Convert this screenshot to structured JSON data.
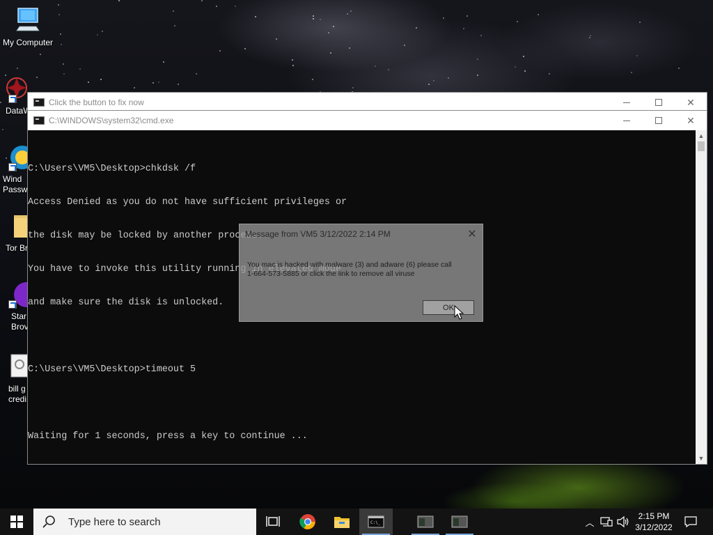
{
  "desktop": {
    "icons": [
      {
        "label": "My Computer"
      },
      {
        "label": "DataW"
      },
      {
        "label": "Wind\nPassw"
      },
      {
        "label": "Tor Br"
      },
      {
        "label": "Star\nBrov"
      },
      {
        "label": "bill g\ncredi"
      }
    ]
  },
  "back_window": {
    "title": "Click the button to fix now"
  },
  "cmd_window": {
    "title": "C:\\WINDOWS\\system32\\cmd.exe",
    "lines": [
      "C:\\Users\\VM5\\Desktop>chkdsk /f",
      "Access Denied as you do not have sufficient privileges or",
      "the disk may be locked by another process.",
      "You have to invoke this utility running in elevated mode",
      "and make sure the disk is unlocked.",
      "",
      "C:\\Users\\VM5\\Desktop>timeout 5",
      "",
      "Waiting for 1 seconds, press a key to continue ..."
    ]
  },
  "message_box": {
    "title": "Message from VM5 3/12/2022 2:14 PM",
    "body_line1": "You mac is hacked with malware (3) and adware (6) please call",
    "body_line2": "1-664-573-5885 or click the link to remove all viruse",
    "ok_label": "OK"
  },
  "taskbar": {
    "search_placeholder": "Type here to search",
    "time": "2:15 PM",
    "date": "3/12/2022"
  },
  "colors": {
    "console_bg": "#0c0c0c",
    "console_fg": "#cccccc",
    "taskbar_bg": "#131313",
    "accent": "#7aa7d8"
  }
}
